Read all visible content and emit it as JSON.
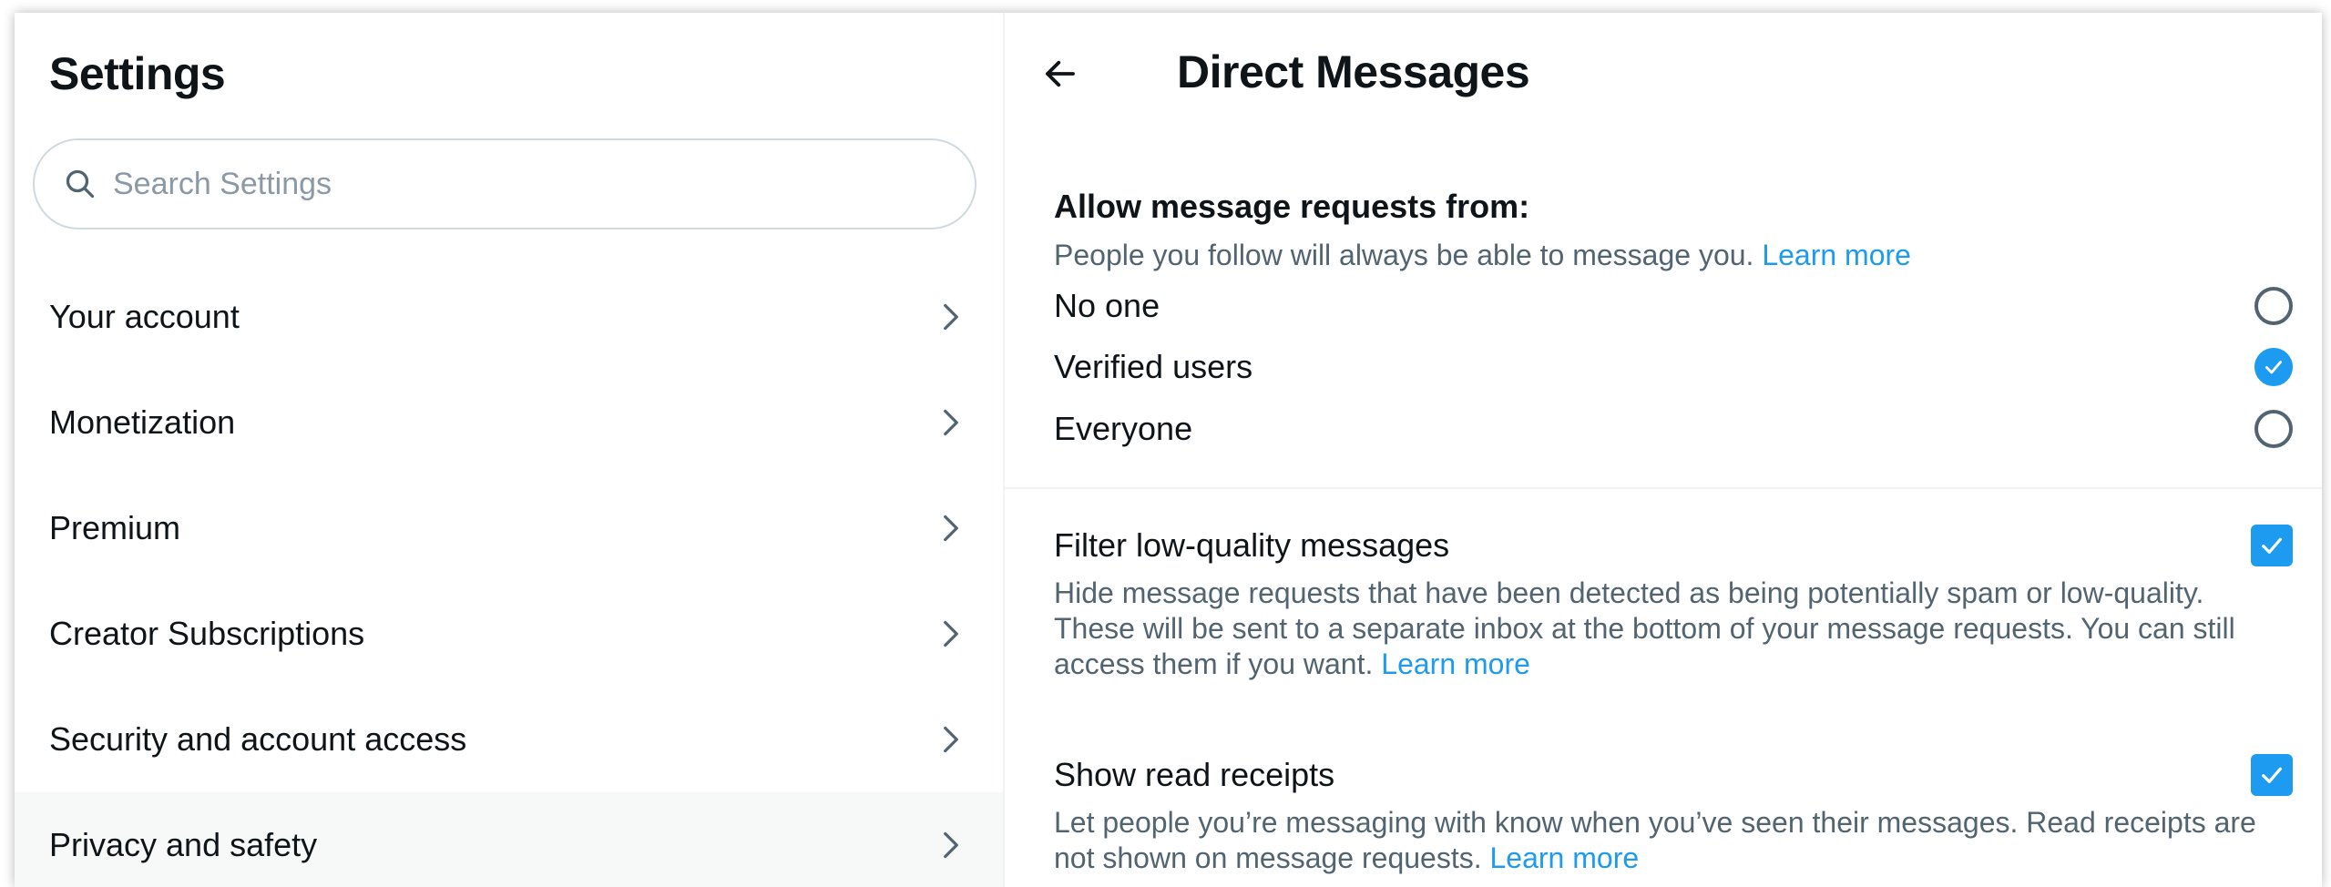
{
  "left": {
    "title": "Settings",
    "search": {
      "placeholder": "Search Settings"
    },
    "nav_items": [
      {
        "label": "Your account"
      },
      {
        "label": "Monetization"
      },
      {
        "label": "Premium"
      },
      {
        "label": "Creator Subscriptions"
      },
      {
        "label": "Security and account access"
      },
      {
        "label": "Privacy and safety",
        "active": true
      }
    ]
  },
  "right": {
    "title": "Direct Messages",
    "allow_section": {
      "heading": "Allow message requests from:",
      "subtext": "People you follow will always be able to message you.",
      "learn_more": "Learn more",
      "options": [
        {
          "label": "No one",
          "selected": false
        },
        {
          "label": "Verified users",
          "selected": true
        },
        {
          "label": "Everyone",
          "selected": false
        }
      ]
    },
    "filter": {
      "label": "Filter low-quality messages",
      "checked": true,
      "description": "Hide message requests that have been detected as being potentially spam or low-quality. These will be sent to a separate inbox at the bottom of your message requests. You can still access them if you want.",
      "learn_more": "Learn more"
    },
    "read_receipts": {
      "label": "Show read receipts",
      "checked": true,
      "description": "Let people you’re messaging with know when you’ve seen their messages. Read receipts are not shown on message requests.",
      "learn_more": "Learn more"
    }
  },
  "colors": {
    "accent": "#1d9bf0",
    "text_primary": "#0f1419",
    "text_secondary": "#536471",
    "active_bg": "#f7f9f9"
  },
  "icons": {
    "search": "search-icon",
    "chevron": "chevron-right-icon",
    "back": "arrow-left-icon",
    "check": "check-icon"
  }
}
